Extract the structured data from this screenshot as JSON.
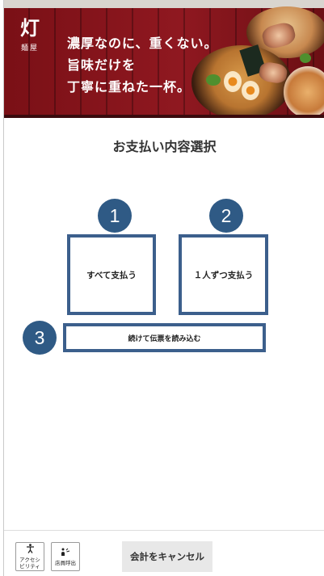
{
  "banner": {
    "logo_kanji": "灯",
    "logo_sub": "麺屋",
    "tagline": [
      "濃厚なのに、重くない。",
      "旨味だけを",
      "丁寧に重ねた一杯。"
    ]
  },
  "page": {
    "title": "お支払い内容選択"
  },
  "options": [
    {
      "number": "1",
      "label": "すべて支払う"
    },
    {
      "number": "2",
      "label": "１人ずつ支払う"
    },
    {
      "number": "3",
      "label": "続けて伝票を読み込む"
    }
  ],
  "footer": {
    "accessibility": {
      "icon": "accessibility-icon",
      "label_line1": "アクセシ",
      "label_line2": "ビリティ"
    },
    "call_staff": {
      "icon": "call-staff-icon",
      "label": "店員呼出"
    },
    "cancel_label": "会計をキャンセル"
  },
  "colors": {
    "accent": "#3c5f8c",
    "badge": "#2f5a85",
    "banner": "#8f1820"
  }
}
